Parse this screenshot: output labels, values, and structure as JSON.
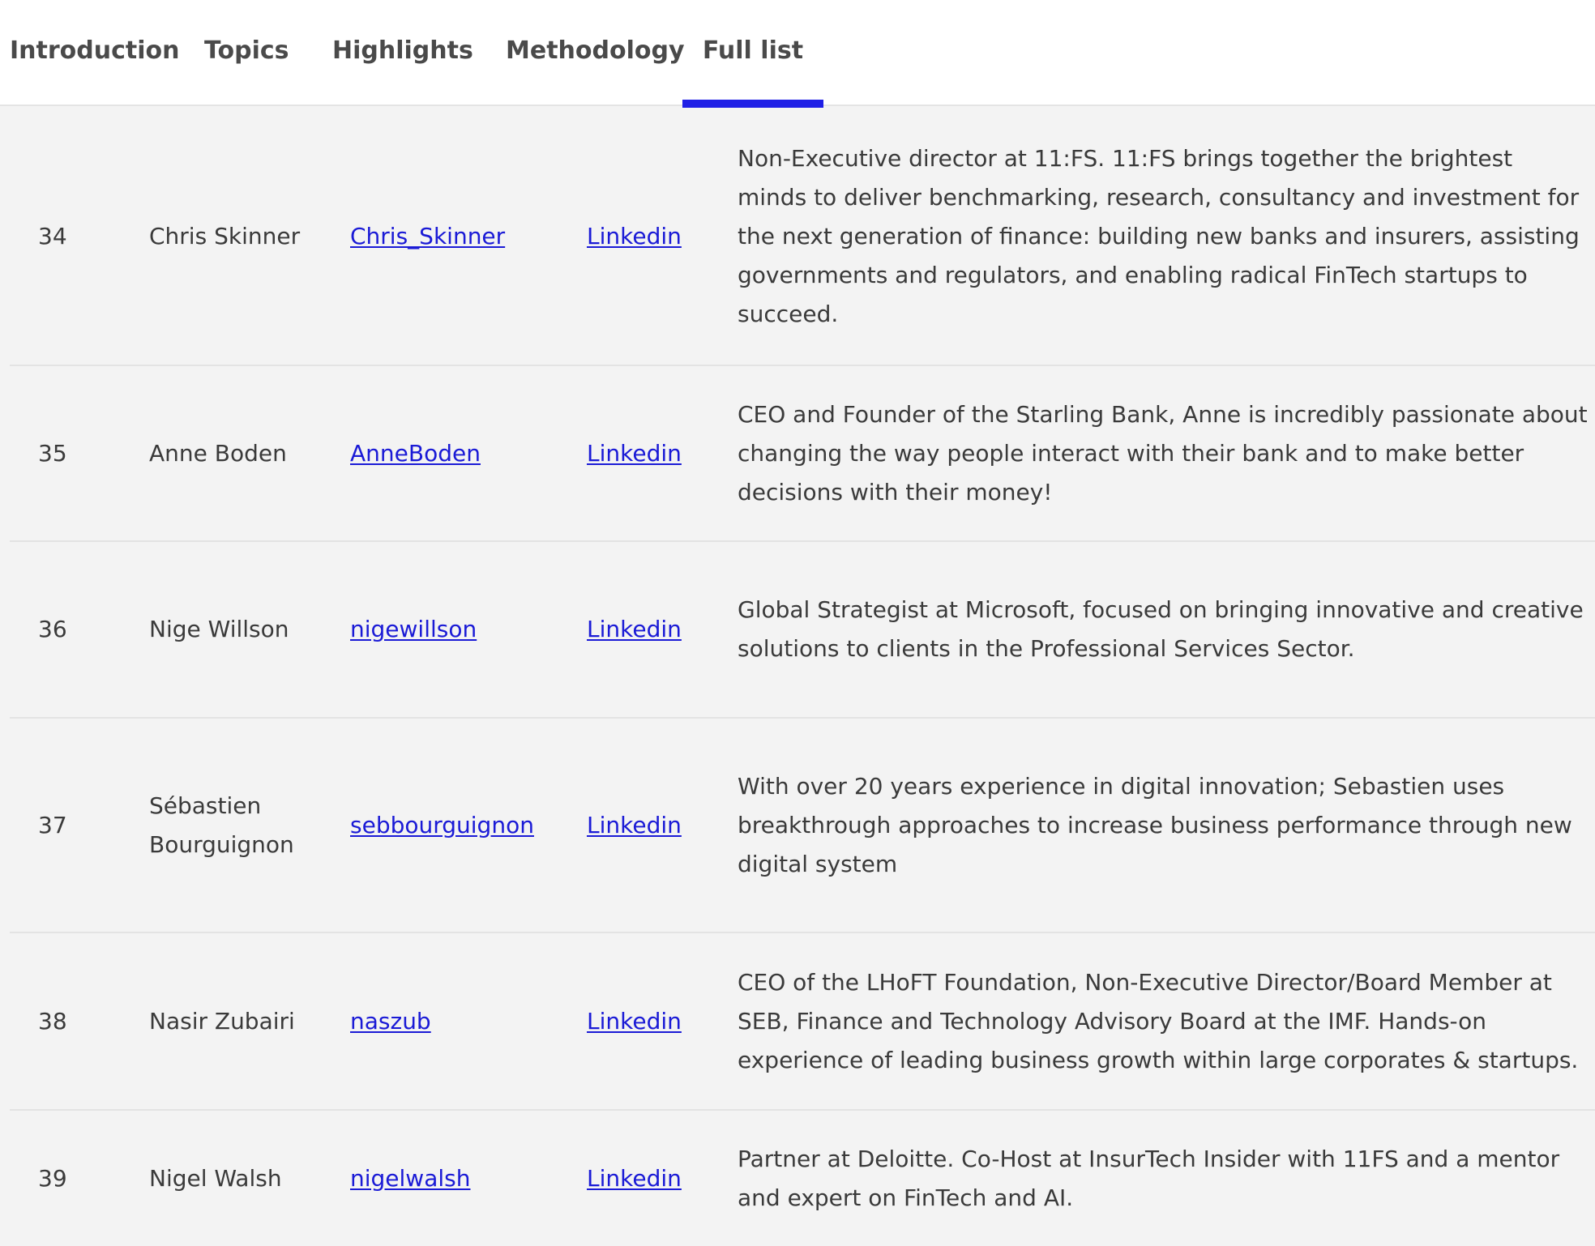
{
  "tabs": [
    {
      "label": "Introduction",
      "active": false
    },
    {
      "label": "Topics",
      "active": false
    },
    {
      "label": "Highlights",
      "active": false
    },
    {
      "label": "Methodology",
      "active": false
    },
    {
      "label": "Full list",
      "active": true
    }
  ],
  "colors": {
    "accent": "#1f1fe6",
    "link": "#1a1ad6",
    "background": "#f3f3f3"
  },
  "rows": [
    {
      "rank": "34",
      "name": "Chris Skinner",
      "handle": "Chris_Skinner",
      "link": "Linkedin",
      "description": "Non-Executive director at 11:FS. 11:FS brings together the brightest minds to deliver benchmarking, research, consultancy and investment for the next generation of finance: building new banks and insurers, assisting governments and regulators, and enabling radical FinTech startups to succeed."
    },
    {
      "rank": "35",
      "name": "Anne Boden",
      "handle": "AnneBoden",
      "link": "Linkedin",
      "description": "CEO and Founder of the Starling Bank, Anne is incredibly passionate about changing the way people interact with their bank and to make better decisions with their money!"
    },
    {
      "rank": "36",
      "name": "Nige Willson",
      "handle": "nigewillson",
      "link": "Linkedin",
      "description": "Global Strategist at Microsoft, focused on bringing innovative and creative solutions to clients in the Professional Services Sector."
    },
    {
      "rank": "37",
      "name": "Sébastien Bourguignon",
      "handle": "sebbourguignon",
      "link": "Linkedin",
      "description": "With over 20 years experience in digital innovation; Sebastien uses breakthrough approaches to increase business performance through new digital system"
    },
    {
      "rank": "38",
      "name": "Nasir Zubairi",
      "handle": "naszub",
      "link": "Linkedin",
      "description": "CEO of the LHoFT Foundation, Non-Executive Director/Board Member at SEB, Finance and Technology Advisory Board at the IMF. Hands-on experience of leading business growth within large corporates & startups."
    },
    {
      "rank": "39",
      "name": "Nigel Walsh",
      "handle": "nigelwalsh",
      "link": "Linkedin",
      "description": "Partner at Deloitte. Co-Host at InsurTech Insider with 11FS and a mentor and expert on FinTech and AI."
    }
  ]
}
